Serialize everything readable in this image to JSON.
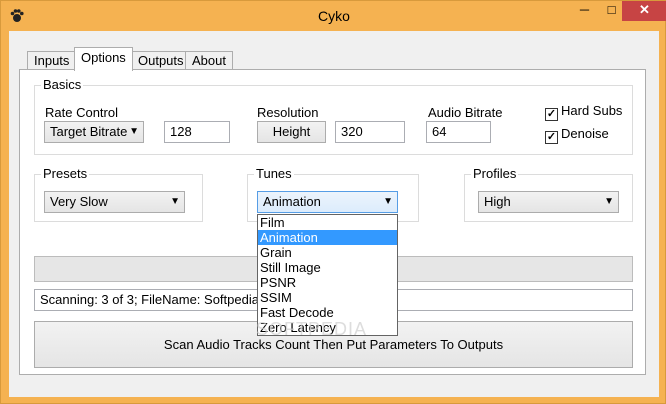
{
  "window": {
    "title": "Cyko",
    "minimize": "─",
    "maximize": "□",
    "close": "✕",
    "icon": "paw-icon"
  },
  "tabs": [
    {
      "label": "Inputs"
    },
    {
      "label": "Options"
    },
    {
      "label": "Outputs"
    },
    {
      "label": "About"
    }
  ],
  "basics": {
    "title": "Basics",
    "rate_control_label": "Rate Control",
    "rate_control_value": "Target Bitrate",
    "rate_value": "128",
    "resolution_label": "Resolution",
    "resolution_button": "Height",
    "resolution_value": "320",
    "audio_bitrate_label": "Audio Bitrate",
    "audio_bitrate_value": "64",
    "hard_subs_label": "Hard Subs",
    "denoise_label": "Denoise"
  },
  "presets": {
    "title": "Presets",
    "value": "Very Slow"
  },
  "tunes": {
    "title": "Tunes",
    "value": "Animation",
    "options": [
      "Film",
      "Animation",
      "Grain",
      "Still Image",
      "PSNR",
      "SSIM",
      "Fast Decode",
      "Zero Latency"
    ],
    "selected": "Animation"
  },
  "profiles": {
    "title": "Profiles",
    "value": "High"
  },
  "status": {
    "text": "Scanning: 3 of 3; FileName: Softpedia1.av"
  },
  "scan_button": {
    "label": "Scan Audio Tracks Count Then Put Parameters To Outputs"
  },
  "watermark": {
    "text": "SOFTPEDIA"
  }
}
